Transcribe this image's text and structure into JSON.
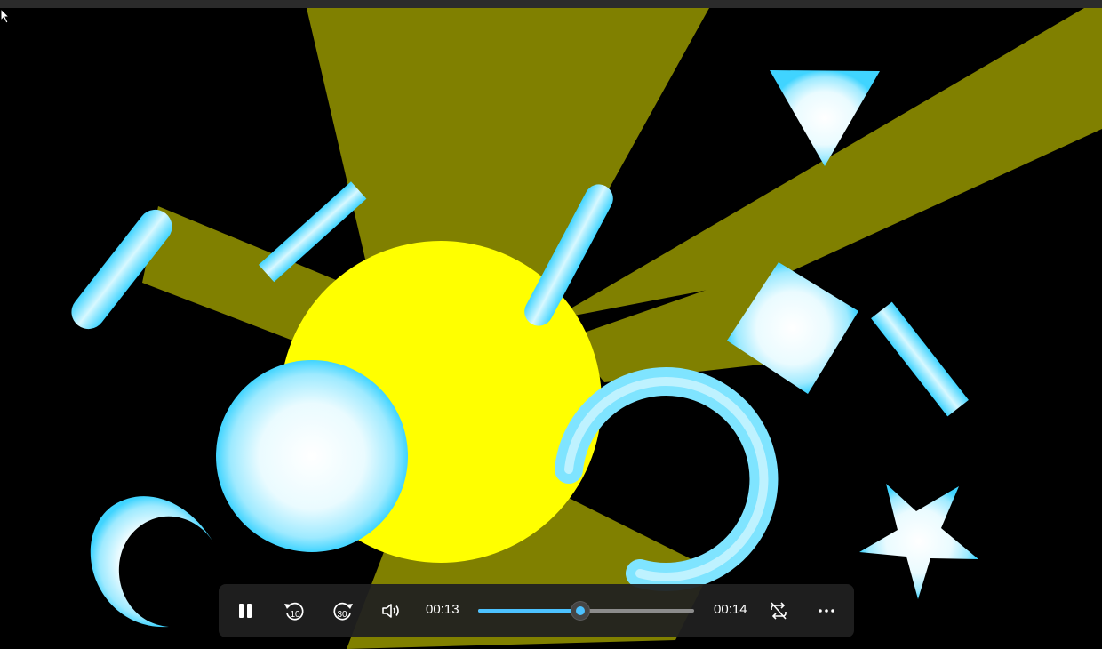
{
  "app": "Video player",
  "playback": {
    "current_time": "00:13",
    "total_time": "00:14",
    "progress": 0.473,
    "state": "playing"
  },
  "controls": {
    "pause_icon": "pause-icon",
    "rewind_icon": "rewind-10-icon",
    "rewind_seconds": "10",
    "forward_icon": "forward-30-icon",
    "forward_seconds": "30",
    "volume_icon": "volume-icon",
    "repeat_icon": "repeat-off-icon",
    "more_icon": "more-options-icon"
  },
  "colors": {
    "accent": "#4cc2ff",
    "sun": "#ffff00",
    "ray": "#808000",
    "shape": "#66ddff"
  }
}
